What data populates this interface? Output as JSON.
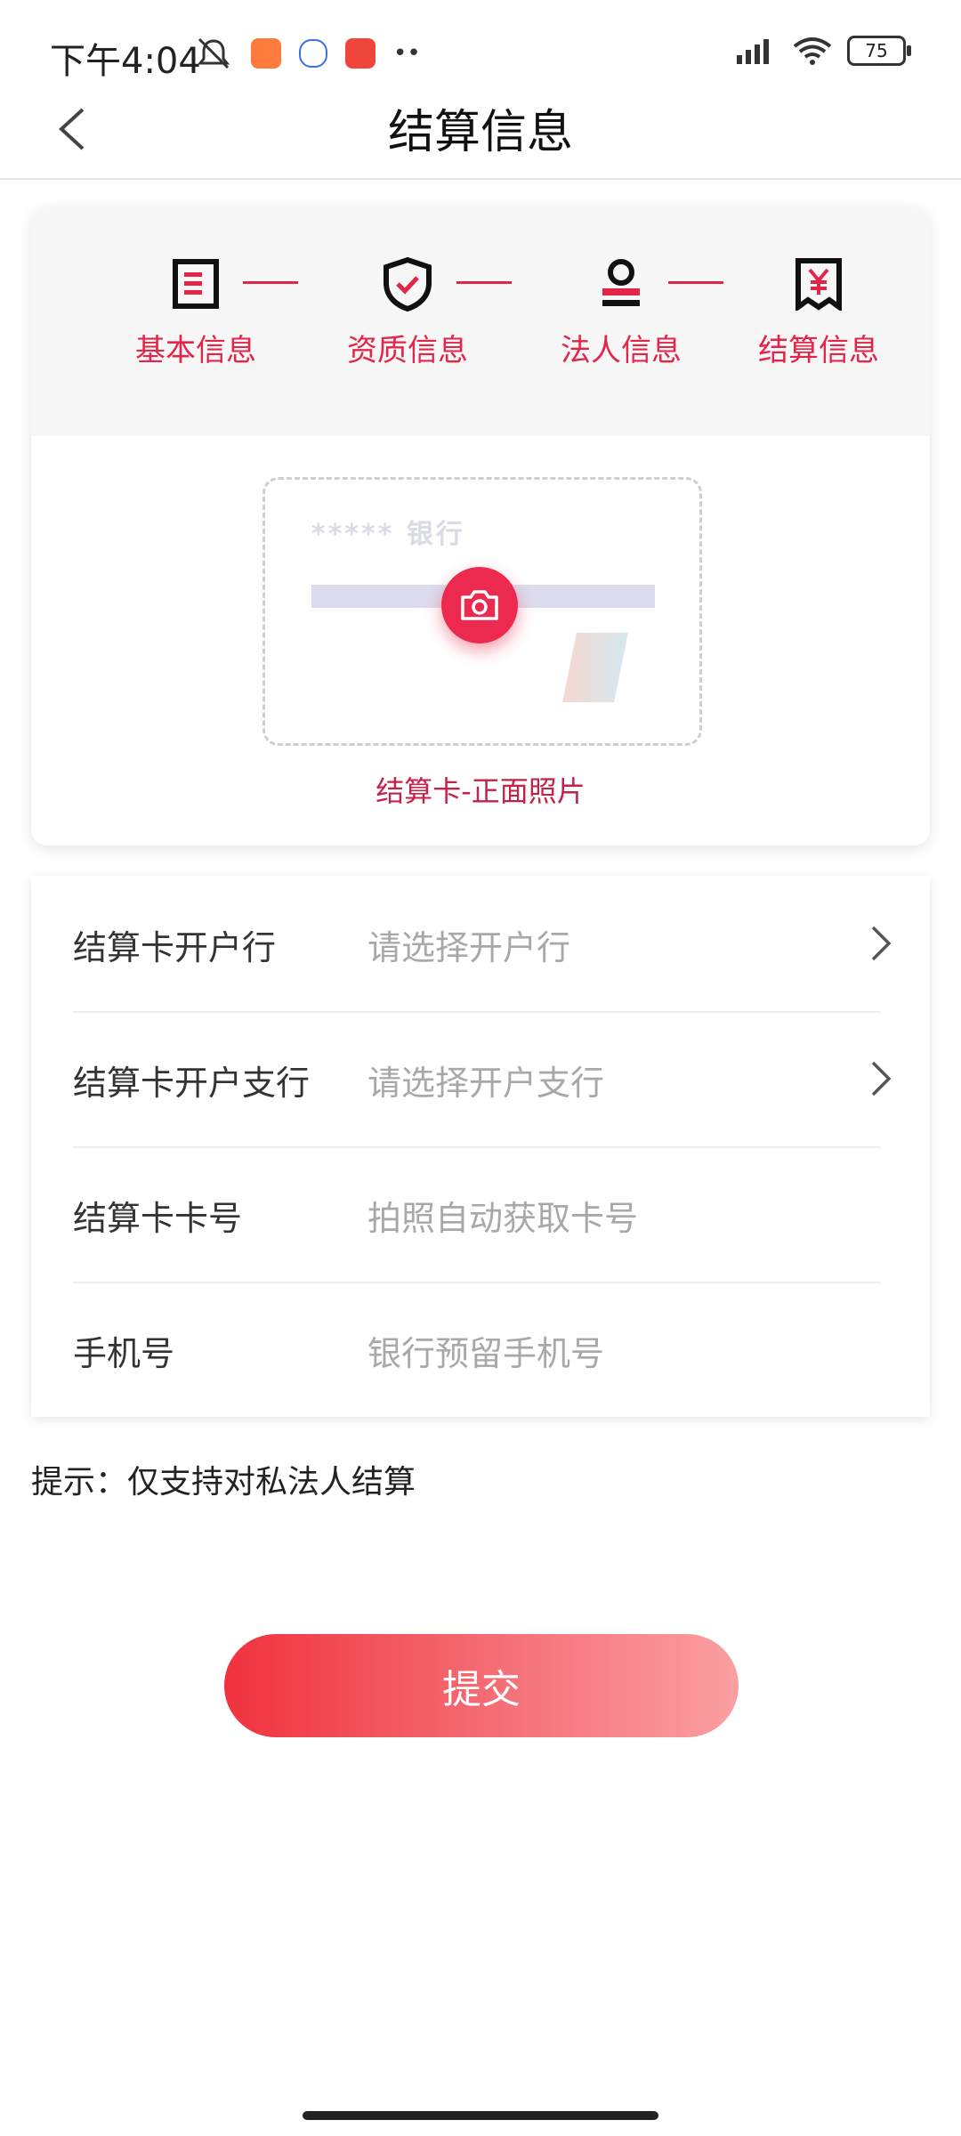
{
  "status_bar": {
    "time": "下午4:04",
    "dots": "••",
    "battery": "75"
  },
  "header": {
    "title": "结算信息"
  },
  "steps": [
    {
      "label": "基本信息",
      "icon": "document-icon"
    },
    {
      "label": "资质信息",
      "icon": "shield-check-icon"
    },
    {
      "label": "法人信息",
      "icon": "person-icon"
    },
    {
      "label": "结算信息",
      "icon": "receipt-yuan-icon"
    }
  ],
  "card_photo": {
    "bank_placeholder": "***** 银行",
    "caption": "结算卡-正面照片"
  },
  "form": {
    "rows": [
      {
        "label": "结算卡开户行",
        "value": "请选择开户行"
      },
      {
        "label": "结算卡开户支行",
        "value": "请选择开户支行"
      },
      {
        "label": "结算卡卡号",
        "value": "拍照自动获取卡号"
      },
      {
        "label": "手机号",
        "value": "银行预留手机号"
      }
    ]
  },
  "hint": "提示：仅支持对私法人结算",
  "submit_label": "提交",
  "colors": {
    "accent": "#e3254a",
    "button_start": "#f0323e",
    "button_end": "#fb9fa1"
  }
}
